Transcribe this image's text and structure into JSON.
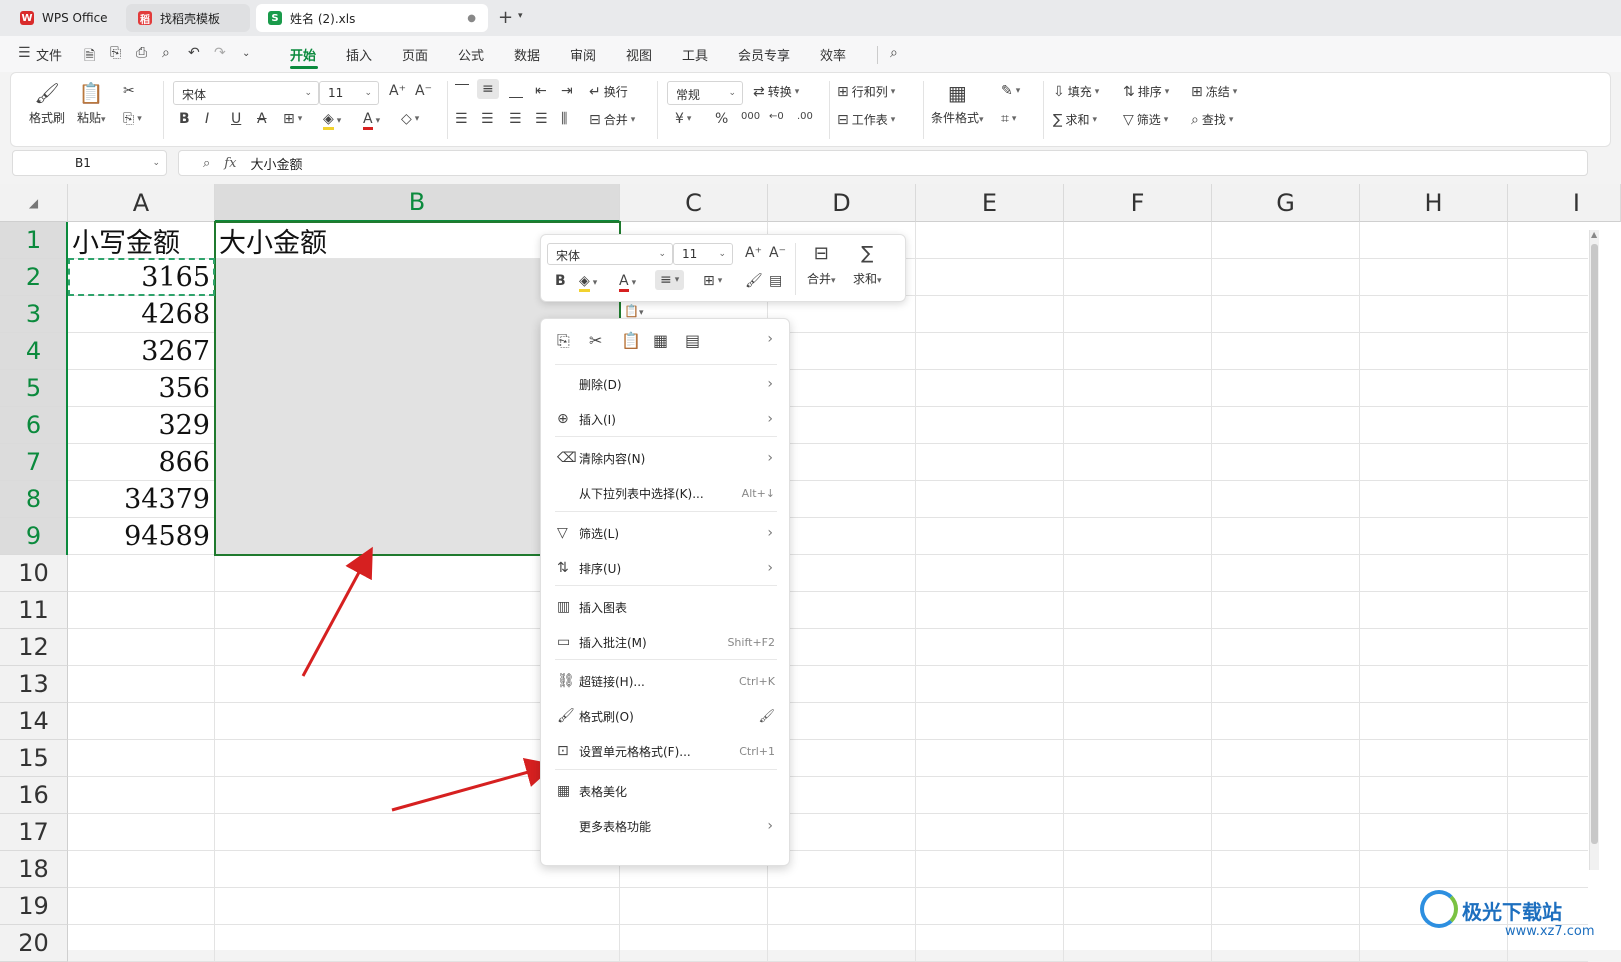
{
  "tabs": [
    {
      "label": "WPS Office",
      "icon": "wps-logo-icon",
      "color": "#d92b2b"
    },
    {
      "label": "找稻壳模板",
      "icon": "docer-icon",
      "color": "#e23b3b"
    },
    {
      "label": "姓名 (2).xls",
      "icon": "spreadsheet-icon",
      "color": "#1a9b4b",
      "active": true
    }
  ],
  "menu": {
    "file_label": "文件",
    "items": [
      "开始",
      "插入",
      "页面",
      "公式",
      "数据",
      "审阅",
      "视图",
      "工具",
      "会员专享",
      "效率"
    ],
    "active": "开始"
  },
  "ribbon": {
    "format_painter": "格式刷",
    "paste": "粘贴",
    "font_name": "宋体",
    "font_size": "11",
    "wrap": "换行",
    "merge": "合并",
    "number_format": "常规",
    "convert": "转换",
    "row_col": "行和列",
    "worksheet": "工作表",
    "cond_format": "条件格式",
    "fill": "填充",
    "sort": "排序",
    "freeze": "冻结",
    "sum": "求和",
    "filter": "筛选",
    "find": "查找"
  },
  "formula_bar": {
    "name_box": "B1",
    "fx": "fx",
    "content": "大小金额"
  },
  "columns": [
    "A",
    "B",
    "C",
    "D",
    "E",
    "F",
    "G",
    "H",
    "I"
  ],
  "selected_column": "B",
  "rows": [
    "1",
    "2",
    "3",
    "4",
    "5",
    "6",
    "7",
    "8",
    "9",
    "10",
    "11",
    "12",
    "13",
    "14",
    "15",
    "16",
    "17",
    "18",
    "19",
    "20"
  ],
  "cells": {
    "A1": "小写金额",
    "B1": "大小金额",
    "A_values": [
      "3165",
      "4268",
      "3267",
      "356",
      "329",
      "866",
      "34379",
      "94589"
    ]
  },
  "mini_toolbar": {
    "font_name": "宋体",
    "font_size": "11",
    "merge": "合并",
    "sum": "求和"
  },
  "context_menu": {
    "items": [
      {
        "label": "删除(D)",
        "shortcut": "",
        "submenu": true,
        "icon": ""
      },
      {
        "label": "插入(I)",
        "shortcut": "",
        "submenu": true,
        "icon": "insert-icon"
      },
      {
        "label": "清除内容(N)",
        "shortcut": "",
        "submenu": true,
        "icon": "clear-icon"
      },
      {
        "label": "从下拉列表中选择(K)...",
        "shortcut": "Alt+↓",
        "submenu": false,
        "icon": ""
      },
      {
        "label": "筛选(L)",
        "shortcut": "",
        "submenu": true,
        "icon": "filter-icon"
      },
      {
        "label": "排序(U)",
        "shortcut": "",
        "submenu": true,
        "icon": "sort-icon"
      },
      {
        "label": "插入图表",
        "shortcut": "",
        "submenu": false,
        "icon": "chart-icon"
      },
      {
        "label": "插入批注(M)",
        "shortcut": "Shift+F2",
        "submenu": false,
        "icon": "comment-icon"
      },
      {
        "label": "超链接(H)...",
        "shortcut": "Ctrl+K",
        "submenu": false,
        "icon": "link-icon"
      },
      {
        "label": "格式刷(O)",
        "shortcut": "",
        "submenu": false,
        "icon": "format-painter-icon"
      },
      {
        "label": "设置单元格格式(F)...",
        "shortcut": "Ctrl+1",
        "submenu": false,
        "icon": "cell-format-icon"
      },
      {
        "label": "表格美化",
        "shortcut": "",
        "submenu": false,
        "icon": "table-beautify-icon"
      },
      {
        "label": "更多表格功能",
        "shortcut": "",
        "submenu": true,
        "icon": ""
      }
    ]
  },
  "watermark": {
    "brand": "极光下载站",
    "url": "www.xz7.com"
  },
  "colors": {
    "accent": "#0b8a3d",
    "arrow": "#d62020"
  }
}
